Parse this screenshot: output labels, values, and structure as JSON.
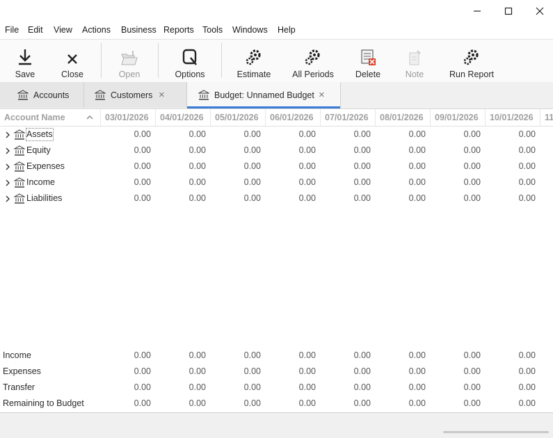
{
  "menu": [
    "File",
    "Edit",
    "View",
    "Actions",
    "Business",
    "Reports",
    "Tools",
    "Windows",
    "Help"
  ],
  "toolbar": {
    "save": "Save",
    "close": "Close",
    "open": "Open",
    "options": "Options",
    "estimate": "Estimate",
    "all_periods": "All Periods",
    "delete": "Delete",
    "note": "Note",
    "run_report": "Run Report"
  },
  "tabs": [
    {
      "label": "Accounts"
    },
    {
      "label": "Customers"
    },
    {
      "label": "Budget: Unnamed Budget"
    }
  ],
  "columns": {
    "account_name": "Account Name",
    "periods": [
      "03/01/2026",
      "04/01/2026",
      "05/01/2026",
      "06/01/2026",
      "07/01/2026",
      "08/01/2026",
      "09/01/2026",
      "10/01/2026",
      "11"
    ]
  },
  "accounts": [
    {
      "name": "Assets",
      "values": [
        "0.00",
        "0.00",
        "0.00",
        "0.00",
        "0.00",
        "0.00",
        "0.00",
        "0.00"
      ]
    },
    {
      "name": "Equity",
      "values": [
        "0.00",
        "0.00",
        "0.00",
        "0.00",
        "0.00",
        "0.00",
        "0.00",
        "0.00"
      ]
    },
    {
      "name": "Expenses",
      "values": [
        "0.00",
        "0.00",
        "0.00",
        "0.00",
        "0.00",
        "0.00",
        "0.00",
        "0.00"
      ]
    },
    {
      "name": "Income",
      "values": [
        "0.00",
        "0.00",
        "0.00",
        "0.00",
        "0.00",
        "0.00",
        "0.00",
        "0.00"
      ]
    },
    {
      "name": "Liabilities",
      "values": [
        "0.00",
        "0.00",
        "0.00",
        "0.00",
        "0.00",
        "0.00",
        "0.00",
        "0.00"
      ]
    }
  ],
  "totals": [
    {
      "label": "Income",
      "values": [
        "0.00",
        "0.00",
        "0.00",
        "0.00",
        "0.00",
        "0.00",
        "0.00",
        "0.00"
      ]
    },
    {
      "label": "Expenses",
      "values": [
        "0.00",
        "0.00",
        "0.00",
        "0.00",
        "0.00",
        "0.00",
        "0.00",
        "0.00"
      ]
    },
    {
      "label": "Transfer",
      "values": [
        "0.00",
        "0.00",
        "0.00",
        "0.00",
        "0.00",
        "0.00",
        "0.00",
        "0.00"
      ]
    },
    {
      "label": "Remaining to Budget",
      "values": [
        "0.00",
        "0.00",
        "0.00",
        "0.00",
        "0.00",
        "0.00",
        "0.00",
        "0.00"
      ]
    }
  ]
}
